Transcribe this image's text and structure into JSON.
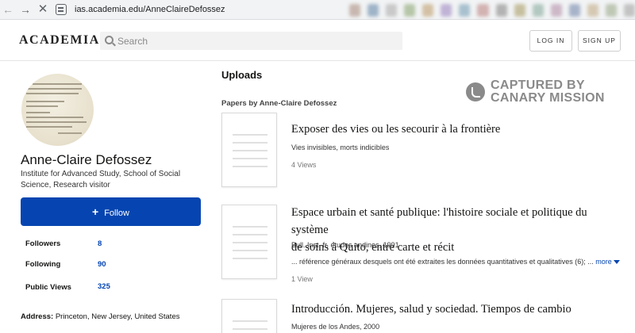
{
  "browser": {
    "url": "ias.academia.edu/AnneClaireDefossez",
    "blurred_chip_colors": [
      "#c8b7b0",
      "#9fb4c8",
      "#c9c9c9",
      "#b6c6a8",
      "#d4c1a5",
      "#c0b3d6",
      "#a9c1cf",
      "#d3b2b2",
      "#b3b3b3",
      "#c7c0a0",
      "#b2c8c0",
      "#cdb8c8",
      "#a7b3c9",
      "#d6c9b3",
      "#bfc7b5",
      "#c3c3c3"
    ]
  },
  "header": {
    "logo": "ACADEMIA",
    "search_placeholder": "Search",
    "login_label": "LOG IN",
    "signup_label": "SIGN UP"
  },
  "profile": {
    "name": "Anne-Claire Defossez",
    "affiliation": "Institute for Advanced Study, School of Social Science, Research visitor",
    "follow_label": "Follow",
    "stats": [
      {
        "label": "Followers",
        "value": "8"
      },
      {
        "label": "Following",
        "value": "90"
      },
      {
        "label": "Public Views",
        "value": "325"
      }
    ],
    "address_label": "Address:",
    "address_value": "Princeton, New Jersey, United States"
  },
  "main": {
    "heading": "Uploads",
    "papers_by": "Papers by Anne-Claire Defossez",
    "watermark_line1": "CAPTURED BY",
    "watermark_line2": "CANARY MISSION",
    "papers": [
      {
        "title": "Exposer des vies ou les secourir à la frontière",
        "meta": "Vies invisibles, morts indicibles",
        "views": "4 Views"
      },
      {
        "title_line1": "Espace urbain et santé publique: l'histoire sociale et politique du système",
        "title_line2": "de soins à Quito, entre carte et récit",
        "meta": "Bull. Inst. fr. études andines, 1991",
        "snippet": "... référence généraux desquels ont été extraites les données quantitatives et qualitatives (6); ...",
        "more_label": "more",
        "views": "1 View"
      },
      {
        "title": "Introducción. Mujeres, salud y sociedad. Tiempos de cambio",
        "meta": "Mujeres de los Andes, 2000"
      }
    ]
  },
  "colors": {
    "brand_blue": "#0645b1",
    "watermark_gray": "#8a8a8a"
  }
}
